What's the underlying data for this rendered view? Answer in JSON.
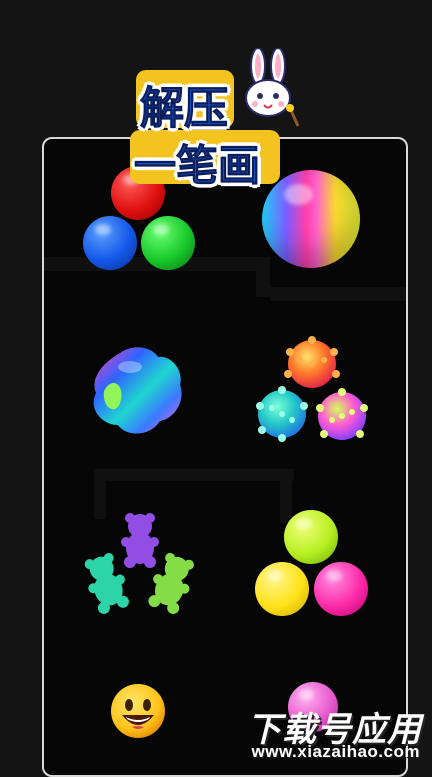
{
  "logo": {
    "line1": "解压",
    "line2": "一笔画",
    "mascot_icon": "rabbit-mascot-icon"
  },
  "watermark": {
    "brand": "下载号应用",
    "url": "www.xiazaihao.com"
  },
  "colors": {
    "panel_border": "#d9d9d9",
    "background": "#141414",
    "logo_text": "#1a5ad8",
    "logo_bg": "#f3c420"
  },
  "items": [
    {
      "id": "three-balls-rgb",
      "icon": "rgb-balls-icon"
    },
    {
      "id": "rainbow-ball",
      "icon": "rainbow-ball-icon"
    },
    {
      "id": "squishy-blob",
      "icon": "squishy-blob-icon"
    },
    {
      "id": "spiky-balls",
      "icon": "spiky-balls-icon"
    },
    {
      "id": "gummy-bears",
      "icon": "gummy-bears-icon"
    },
    {
      "id": "neon-balls",
      "icon": "neon-balls-icon"
    },
    {
      "id": "smiley-emoji",
      "icon": "smiley-emoji-icon"
    },
    {
      "id": "pink-ball",
      "icon": "pink-ball-icon"
    }
  ]
}
